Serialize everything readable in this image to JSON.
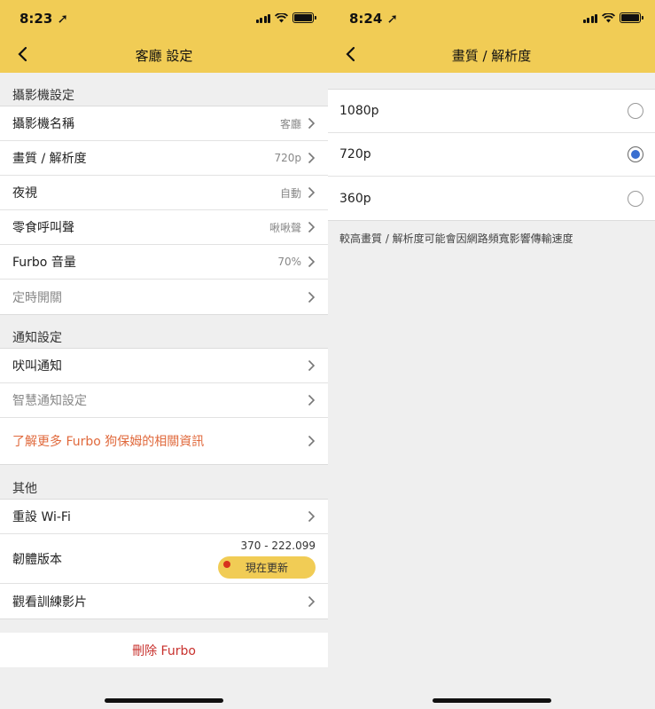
{
  "left": {
    "status": {
      "time": "8:23"
    },
    "header": {
      "title": "客廳 設定"
    },
    "camera_section": {
      "heading": "攝影機設定",
      "rows": [
        {
          "label": "攝影機名稱",
          "value": "客廳"
        },
        {
          "label": "畫質 / 解析度",
          "value": "720p"
        },
        {
          "label": "夜視",
          "value": "自動"
        },
        {
          "label": "零食呼叫聲",
          "value": "啾啾聲"
        },
        {
          "label": "Furbo 音量",
          "value": "70%"
        },
        {
          "label": "定時開關",
          "value": ""
        }
      ]
    },
    "notify_section": {
      "heading": "通知設定",
      "rows": [
        {
          "label": "吠叫通知"
        },
        {
          "label": "智慧通知設定"
        },
        {
          "label": "了解更多 Furbo 狗保姆的相關資訊"
        }
      ]
    },
    "other_section": {
      "heading": "其他",
      "wifi_label": "重設 Wi-Fi",
      "firmware_label": "韌體版本",
      "firmware_version": "370 - 222.099",
      "update_label": "現在更新",
      "video_label": "觀看訓練影片"
    },
    "delete_label": "刪除 Furbo"
  },
  "right": {
    "status": {
      "time": "8:24"
    },
    "header": {
      "title": "畫質 / 解析度"
    },
    "options": [
      {
        "label": "1080p",
        "selected": false
      },
      {
        "label": "720p",
        "selected": true
      },
      {
        "label": "360p",
        "selected": false
      }
    ],
    "note": "較高畫質 / 解析度可能會因網路頻寬影響傳輸速度"
  },
  "colors": {
    "header": "#f1cc55",
    "accent_orange": "#e0693c",
    "delete_red": "#c8312d",
    "radio_selected": "#3a6fd0"
  }
}
